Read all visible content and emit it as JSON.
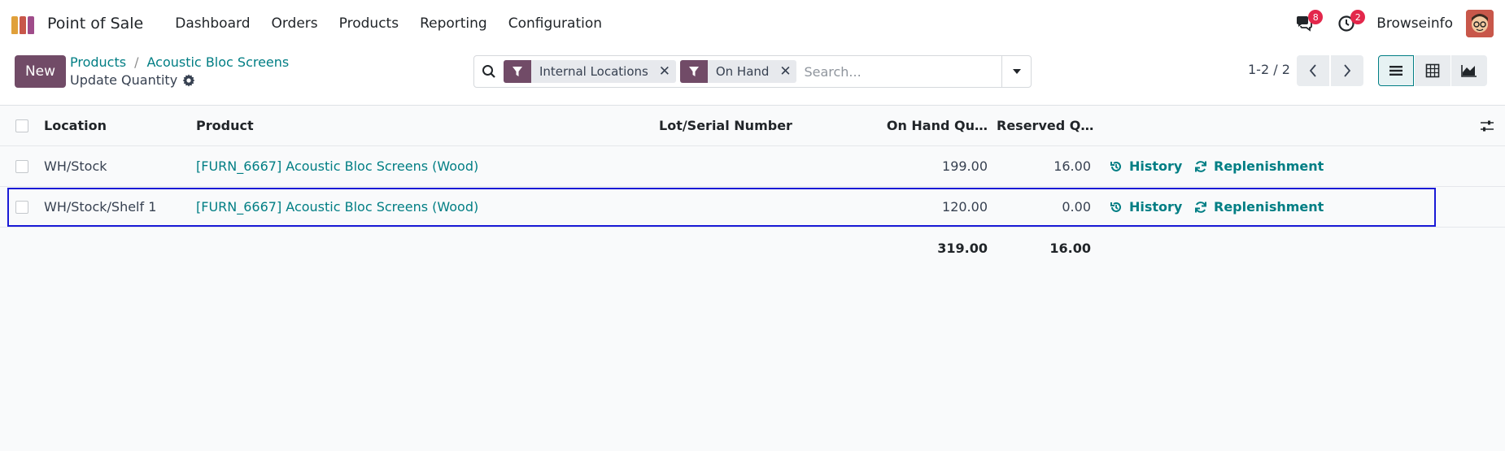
{
  "app": {
    "name": "Point of Sale",
    "logo_colors": [
      "#e0a03a",
      "#c8574a",
      "#9f4c8a",
      "#f0b54a"
    ]
  },
  "menu": [
    {
      "label": "Dashboard"
    },
    {
      "label": "Orders"
    },
    {
      "label": "Products"
    },
    {
      "label": "Reporting"
    },
    {
      "label": "Configuration"
    }
  ],
  "systray": {
    "messages_count": "8",
    "activities_count": "2",
    "user_name": "Browseinfo"
  },
  "control_panel": {
    "new_label": "New",
    "breadcrumbs": [
      "Products",
      "Acoustic Bloc Screens"
    ],
    "breadcrumb_separator": "/",
    "subtitle": "Update Quantity",
    "search": {
      "facets": [
        {
          "label": "Internal Locations"
        },
        {
          "label": "On Hand"
        }
      ],
      "placeholder": "Search..."
    },
    "pager": "1-2 / 2"
  },
  "table": {
    "columns": [
      "Location",
      "Product",
      "Lot/Serial Number",
      "On Hand Qu…",
      "Reserved Q…"
    ],
    "rows": [
      {
        "location": "WH/Stock",
        "product": "[FURN_6667] Acoustic Bloc Screens (Wood)",
        "lot": "",
        "on_hand": "199.00",
        "reserved": "16.00",
        "history": "History",
        "replenishment": "Replenishment"
      },
      {
        "location": "WH/Stock/Shelf 1",
        "product": "[FURN_6667] Acoustic Bloc Screens (Wood)",
        "lot": "",
        "on_hand": "120.00",
        "reserved": "0.00",
        "history": "History",
        "replenishment": "Replenishment"
      }
    ],
    "totals": {
      "on_hand": "319.00",
      "reserved": "16.00"
    }
  },
  "colors": {
    "primary": "#714b67",
    "link": "#017e84",
    "badge": "#e3274b",
    "selection_outline": "#1a1ad6"
  }
}
